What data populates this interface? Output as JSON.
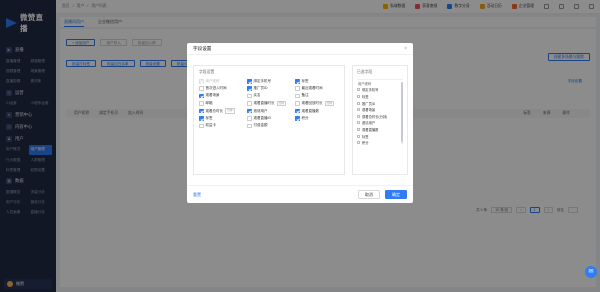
{
  "app": {
    "brand": "微赞直播",
    "user_label": "微赞"
  },
  "sidebar": {
    "groups": [
      {
        "title": "直播",
        "items": [
          "直播管理",
          "频道管理",
          "视频管理",
          "场景管理",
          "直播剪辑",
          "素材库"
        ]
      },
      {
        "title": "运营",
        "items": [
          "CI运营",
          "小程序运营"
        ]
      },
      {
        "title": "营销中心",
        "items": []
      },
      {
        "title": "内容中心",
        "items": []
      },
      {
        "title": "用户",
        "items": [
          "用户概况",
          "用户管理",
          "行为数据",
          "人群管理",
          "标签管理",
          "权限设置"
        ]
      },
      {
        "title": "数据",
        "items": [
          "数据概览",
          "流量分析",
          "用户分析",
          "营收分析",
          "人员画像",
          "直播分析"
        ]
      }
    ],
    "active_item": "用户管理"
  },
  "topbar": {
    "breadcrumbs": [
      "首页",
      "用户",
      "用户列表"
    ],
    "actions": [
      {
        "label": "私域数据",
        "color": "#f7b500"
      },
      {
        "label": "获客套餐",
        "color": "#f5515f"
      },
      {
        "label": "数字分身",
        "color": "#2f7cf6"
      },
      {
        "label": "活动日历",
        "color": "#f5a623"
      },
      {
        "label": "企业管理",
        "color": "#f56b2a"
      }
    ]
  },
  "page": {
    "tabs": [
      "直播间用户",
      "企业微信用户"
    ],
    "buttons": [
      "+ 添加用户",
      "用户导入",
      "批量加入群"
    ],
    "row2_buttons": [
      "批量打标签",
      "批量加白名单",
      "批量设置",
      "批量设置"
    ],
    "right_button": "创建多场景与跟踪",
    "field_settings_link": "字段设置",
    "table_columns": [
      "用户昵称",
      "绑定手机号",
      "加入时间",
      "标签",
      "来源",
      "操作"
    ],
    "pagination": {
      "total": "共 0 条",
      "page_size": "10 条/页",
      "current": "1",
      "goto": "前往"
    }
  },
  "modal": {
    "title": "字段设置",
    "left_title": "字段设置",
    "fields": [
      {
        "label": "用户昵称",
        "checked": true,
        "disabled": true,
        "tag": ""
      },
      {
        "label": "绑定手机号",
        "checked": true,
        "disabled": false,
        "tag": ""
      },
      {
        "label": "标签",
        "checked": true,
        "disabled": false,
        "tag": ""
      },
      {
        "label": "首次进入时间",
        "checked": false,
        "disabled": false,
        "tag": ""
      },
      {
        "label": "推广员ID",
        "checked": true,
        "disabled": false,
        "tag": ""
      },
      {
        "label": "最近观看时间",
        "checked": false,
        "disabled": false,
        "tag": ""
      },
      {
        "label": "观看场景",
        "checked": true,
        "disabled": false,
        "tag": ""
      },
      {
        "label": "实名",
        "checked": false,
        "disabled": false,
        "tag": ""
      },
      {
        "label": "备注",
        "checked": false,
        "disabled": false,
        "tag": ""
      },
      {
        "label": "邮箱",
        "checked": false,
        "disabled": false,
        "tag": ""
      },
      {
        "label": "观看直播时长",
        "checked": false,
        "disabled": false,
        "tag": "分钟"
      },
      {
        "label": "观看回放时长",
        "checked": false,
        "disabled": false,
        "tag": "分钟"
      },
      {
        "label": "观看总时长",
        "checked": true,
        "disabled": false,
        "tag": "分钟"
      },
      {
        "label": "邀请用户",
        "checked": true,
        "disabled": false,
        "tag": ""
      },
      {
        "label": "观看直播数",
        "checked": true,
        "disabled": false,
        "tag": ""
      },
      {
        "label": "标签",
        "checked": true,
        "disabled": false,
        "tag": ""
      },
      {
        "label": "观看直播ID",
        "checked": false,
        "disabled": false,
        "tag": ""
      },
      {
        "label": "积分",
        "checked": true,
        "disabled": false,
        "tag": ""
      },
      {
        "label": "权益卡",
        "checked": false,
        "disabled": false,
        "tag": ""
      },
      {
        "label": "付费金额",
        "checked": false,
        "disabled": false,
        "tag": ""
      }
    ],
    "right_title": "已选字段",
    "selected": [
      {
        "label": "用户昵称",
        "fixed": true
      },
      {
        "label": "绑定手机号",
        "fixed": false
      },
      {
        "label": "标签",
        "fixed": false
      },
      {
        "label": "推广员ID",
        "fixed": false
      },
      {
        "label": "观看场景",
        "fixed": false
      },
      {
        "label": "观看总时长(分钟)",
        "fixed": false
      },
      {
        "label": "邀请用户",
        "fixed": false
      },
      {
        "label": "观看直播数",
        "fixed": false
      },
      {
        "label": "标签",
        "fixed": false
      },
      {
        "label": "积分",
        "fixed": false
      }
    ],
    "reset_label": "重置",
    "cancel_label": "取消",
    "confirm_label": "确定"
  }
}
